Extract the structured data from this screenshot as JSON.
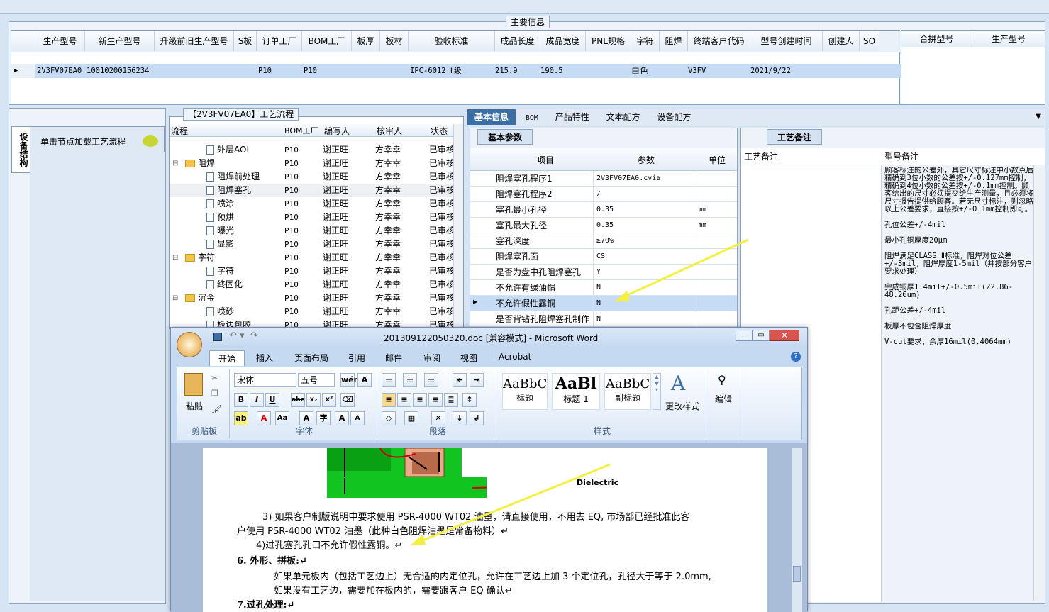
{
  "main_info": {
    "title": "主要信息",
    "columns": [
      "生产型号",
      "新生产型号",
      "升级前旧生产型号",
      "S板",
      "订单工厂",
      "BOM工厂",
      "板厚",
      "板材",
      "验收标准",
      "成品长度",
      "成品宽度",
      "PNL规格",
      "字符",
      "阻焊",
      "终端客户代码",
      "型号创建时间",
      "创建人",
      "SO"
    ],
    "row": {
      "生产型号": "2V3FV07EA0",
      "新生产型号": "10010200156234",
      "订单工厂": "P10",
      "BOM工厂": "P10",
      "验收标准": "IPC-6012 Ⅱ级",
      "成品长度": "215.9",
      "成品宽度": "190.5",
      "字符": "白色",
      "终端客户代码": "V3FV",
      "型号创建时间": "2021/9/22"
    },
    "merge_columns": [
      "合拼型号",
      "生产型号"
    ]
  },
  "sidebar": {
    "vertical_tab": "设备结构",
    "hint": "单击节点加载工艺流程"
  },
  "process": {
    "title": "【2V3FV07EA0】工艺流程",
    "columns": [
      "流程",
      "BOM工厂",
      "编写人",
      "核审人",
      "状态"
    ],
    "rows": [
      {
        "name": "外层AOI",
        "type": "doc",
        "bom": "P10",
        "writer": "谢正旺",
        "checker": "方幸幸",
        "status": "已审核"
      },
      {
        "name": "阻焊",
        "type": "folder",
        "bom": "P10",
        "writer": "谢正旺",
        "checker": "方幸幸",
        "status": "已审核"
      },
      {
        "name": "阻焊前处理",
        "type": "doc",
        "bom": "P10",
        "writer": "谢正旺",
        "checker": "方幸幸",
        "status": "已审核"
      },
      {
        "name": "阻焊塞孔",
        "type": "doc",
        "bom": "P10",
        "writer": "谢正旺",
        "checker": "方幸幸",
        "status": "已审核"
      },
      {
        "name": "喷涂",
        "type": "doc",
        "bom": "P10",
        "writer": "谢正旺",
        "checker": "方幸幸",
        "status": "已审核"
      },
      {
        "name": "预烘",
        "type": "doc",
        "bom": "P10",
        "writer": "谢正旺",
        "checker": "方幸幸",
        "status": "已审核"
      },
      {
        "name": "曝光",
        "type": "doc",
        "bom": "P10",
        "writer": "谢正旺",
        "checker": "方幸幸",
        "status": "已审核"
      },
      {
        "name": "显影",
        "type": "doc",
        "bom": "P10",
        "writer": "谢正旺",
        "checker": "方幸幸",
        "status": "已审核"
      },
      {
        "name": "字符",
        "type": "folder",
        "bom": "P10",
        "writer": "谢正旺",
        "checker": "方幸幸",
        "status": "已审核"
      },
      {
        "name": "字符",
        "type": "doc",
        "bom": "P10",
        "writer": "谢正旺",
        "checker": "方幸幸",
        "status": "已审核"
      },
      {
        "name": "终固化",
        "type": "doc",
        "bom": "P10",
        "writer": "谢正旺",
        "checker": "方幸幸",
        "status": "已审核"
      },
      {
        "name": "沉金",
        "type": "folder",
        "bom": "P10",
        "writer": "谢正旺",
        "checker": "方幸幸",
        "status": "已审核"
      },
      {
        "name": "喷砂",
        "type": "doc",
        "bom": "P10",
        "writer": "谢正旺",
        "checker": "方幸幸",
        "status": "已审核"
      },
      {
        "name": "板边包胶",
        "type": "doc",
        "bom": "P10",
        "writer": "谢正旺",
        "checker": "方幸幸",
        "status": "已审核"
      }
    ]
  },
  "detail_tabs": [
    "基本信息",
    "BOM",
    "产品特性",
    "文本配方",
    "设备配方"
  ],
  "basic_params": {
    "tab": "基本参数",
    "columns": [
      "项目",
      "参数",
      "单位"
    ],
    "rows": [
      {
        "k": "阻焊塞孔程序1",
        "v": "2V3FV07EA0.cvia",
        "u": ""
      },
      {
        "k": "阻焊塞孔程序2",
        "v": "/",
        "u": ""
      },
      {
        "k": "塞孔最小孔径",
        "v": "0.35",
        "u": "mm"
      },
      {
        "k": "塞孔最大孔径",
        "v": "0.35",
        "u": "mm"
      },
      {
        "k": "塞孔深度",
        "v": "≥70%",
        "u": ""
      },
      {
        "k": "阻焊塞孔面",
        "v": "CS",
        "u": ""
      },
      {
        "k": "是否为盘中孔阻焊塞孔",
        "v": "Y",
        "u": ""
      },
      {
        "k": "不允许有绿油帽",
        "v": "N",
        "u": ""
      },
      {
        "k": "不允许假性露铜",
        "v": "N",
        "u": ""
      },
      {
        "k": "是否背钻孔阻焊塞孔制作",
        "v": "N",
        "u": ""
      }
    ]
  },
  "process_notes": {
    "tab": "工艺备注",
    "columns": [
      "工艺备注",
      "型号备注"
    ],
    "notes": [
      "顾客标注的公差外，其它尺寸标注中小数点后精确到3位小数的公差按+/-0.127mm控制，精确到4位小数的公差按+/-0.1mm控制。顾客给出的尺寸必须提交给生产测量，且必须将尺寸报告提供给顾客。若无尺寸标注，则忽略以上公差要求，直接按+/-0.1mm控制即可。",
      "孔位公差+/-4mil",
      "最小孔铜厚度20μm",
      "阻焊满足CLASS Ⅱ标准，阻焊对位公差+/-3mil，阻焊厚度1-5mil（并按部分客户要求处理）",
      "完成铜厚1.4mil+/-0.5mil(22.86-48.26um)",
      "孔距公差+/-4mil",
      "板厚不包含阻焊厚度",
      "V-cut要求，余厚16mil(0.4064mm)"
    ]
  },
  "word": {
    "title": "201309122050320.doc [兼容模式] - Microsoft Word",
    "tabs": [
      "开始",
      "插入",
      "页面布局",
      "引用",
      "邮件",
      "审阅",
      "视图",
      "Acrobat"
    ],
    "font_name": "宋体",
    "font_size": "五号",
    "paste_label": "粘贴",
    "groups": [
      "剪贴板",
      "字体",
      "段落",
      "样式",
      "编辑"
    ],
    "styles": [
      {
        "preview": "AaBbC",
        "name": "标题"
      },
      {
        "preview": "AaBl",
        "name": "标题 1"
      },
      {
        "preview": "AaBbC",
        "name": "副标题"
      }
    ],
    "change_styles": "更改样式",
    "edit_label": "编辑",
    "figure_label": "Dielectric",
    "lines": [
      "3) 如果客户制版说明中要求使用 PSR-4000 WT02 油墨，请直接使用，不用去 EQ, 市场部已经批准此客",
      "户使用 PSR-4000 WT02 油墨（此种白色阻焊油墨是常备物料）↵",
      "4)过孔塞孔孔口不允许假性露铜。↵",
      "6.   外形、拼板:↵",
      "如果单元板内（包括工艺边上）无合适的内定位孔，允许在工艺边上加 3 个定位孔，孔径大于等于 2.0mm,",
      "如果没有工艺边，需要加在板内的，需要跟客户 EQ 确认↵",
      "7.过孔处理:↵"
    ]
  },
  "colors": {
    "selected_row": "#c6dcf5",
    "accent_tab": "#3a6ea5",
    "arrow": "#f4f040",
    "word_chrome": "#c5d9f1"
  }
}
